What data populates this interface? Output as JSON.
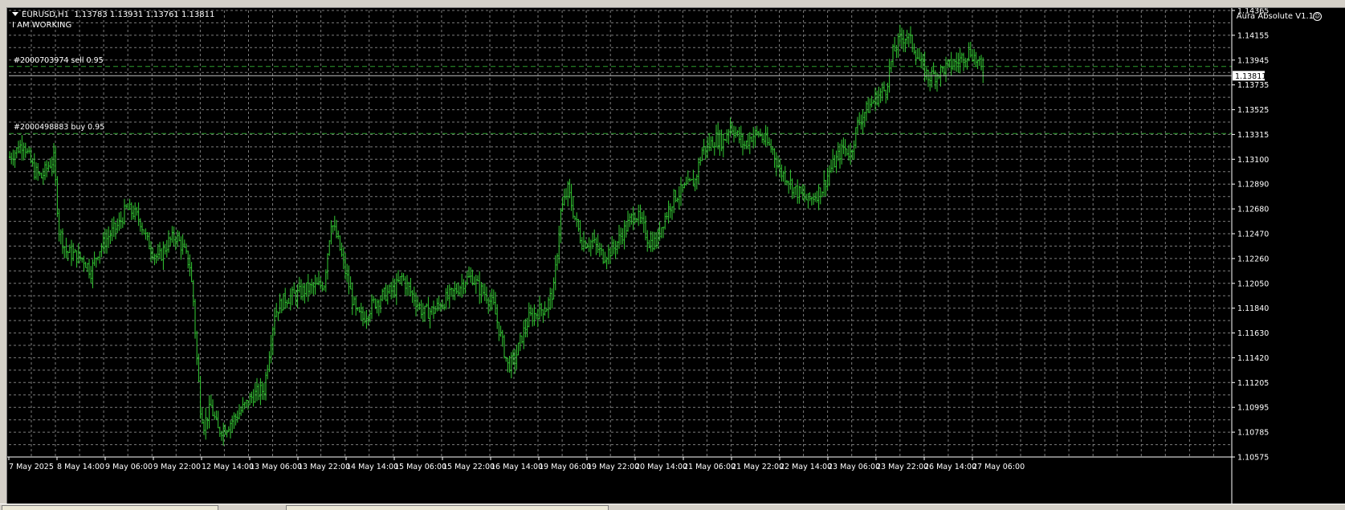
{
  "chart": {
    "symbol": "EURUSD,H1",
    "ohlc": "1.13783 1.13931 1.13761 1.13811",
    "status": "I AM WORKING",
    "expert": "Aura Absolute V1.1",
    "current_price": "1.13811",
    "colors": {
      "background": "#000000",
      "grid": "#8a8a8a",
      "candles": "#33cc33",
      "order_line": "#2ea02e",
      "bid_line": "#c0c0c0",
      "text": "#ffffff"
    }
  },
  "orders": [
    {
      "label": "#2000703974 sell 0.95",
      "price": 1.1389
    },
    {
      "label": "#2000498883 buy 0.95",
      "price": 1.1332
    }
  ],
  "price_axis": [
    "1.14365",
    "1.14155",
    "1.13945",
    "1.13735",
    "1.13525",
    "1.13315",
    "1.13100",
    "1.12890",
    "1.12680",
    "1.12470",
    "1.12260",
    "1.12050",
    "1.11840",
    "1.11630",
    "1.11420",
    "1.11205",
    "1.10995",
    "1.10785",
    "1.10575"
  ],
  "time_axis": [
    "7 May 2025",
    "8 May 14:00",
    "9 May 06:00",
    "9 May 22:00",
    "12 May 14:00",
    "13 May 06:00",
    "13 May 22:00",
    "14 May 14:00",
    "15 May 06:00",
    "15 May 22:00",
    "16 May 14:00",
    "19 May 06:00",
    "19 May 22:00",
    "20 May 14:00",
    "21 May 06:00",
    "21 May 22:00",
    "22 May 14:00",
    "23 May 06:00",
    "23 May 22:00",
    "26 May 14:00",
    "27 May 06:00"
  ],
  "chart_data": {
    "type": "ohlc",
    "title": "EURUSD,H1",
    "ylim": [
      1.10575,
      1.14365
    ],
    "key_points": [
      [
        0,
        1.1312
      ],
      [
        4,
        1.1318
      ],
      [
        8,
        1.1325
      ],
      [
        10,
        1.1315
      ],
      [
        14,
        1.13
      ],
      [
        18,
        1.1295
      ],
      [
        22,
        1.1305
      ],
      [
        25,
        1.131
      ],
      [
        28,
        1.125
      ],
      [
        32,
        1.1232
      ],
      [
        38,
        1.1228
      ],
      [
        42,
        1.1225
      ],
      [
        46,
        1.1215
      ],
      [
        50,
        1.1232
      ],
      [
        56,
        1.1245
      ],
      [
        62,
        1.1255
      ],
      [
        66,
        1.1268
      ],
      [
        70,
        1.1265
      ],
      [
        74,
        1.1258
      ],
      [
        78,
        1.124
      ],
      [
        84,
        1.1225
      ],
      [
        90,
        1.124
      ],
      [
        94,
        1.1245
      ],
      [
        98,
        1.1235
      ],
      [
        102,
        1.122
      ],
      [
        104,
        1.119
      ],
      [
        106,
        1.114
      ],
      [
        108,
        1.11
      ],
      [
        110,
        1.1085
      ],
      [
        114,
        1.11
      ],
      [
        118,
        1.108
      ],
      [
        122,
        1.1082
      ],
      [
        130,
        1.1095
      ],
      [
        138,
        1.111
      ],
      [
        144,
        1.1115
      ],
      [
        150,
        1.118
      ],
      [
        156,
        1.1192
      ],
      [
        162,
        1.1195
      ],
      [
        168,
        1.12
      ],
      [
        174,
        1.1202
      ],
      [
        178,
        1.1205
      ],
      [
        182,
        1.1258
      ],
      [
        186,
        1.124
      ],
      [
        190,
        1.1215
      ],
      [
        196,
        1.118
      ],
      [
        200,
        1.1175
      ],
      [
        206,
        1.1188
      ],
      [
        212,
        1.1195
      ],
      [
        218,
        1.12
      ],
      [
        222,
        1.121
      ],
      [
        228,
        1.1195
      ],
      [
        234,
        1.118
      ],
      [
        240,
        1.1182
      ],
      [
        246,
        1.119
      ],
      [
        252,
        1.1198
      ],
      [
        258,
        1.1208
      ],
      [
        262,
        1.121
      ],
      [
        266,
        1.12
      ],
      [
        270,
        1.1195
      ],
      [
        274,
        1.1185
      ],
      [
        278,
        1.116
      ],
      [
        282,
        1.1135
      ],
      [
        286,
        1.114
      ],
      [
        290,
        1.116
      ],
      [
        294,
        1.1175
      ],
      [
        300,
        1.1182
      ],
      [
        304,
        1.1185
      ],
      [
        308,
        1.12
      ],
      [
        312,
        1.1265
      ],
      [
        316,
        1.1285
      ],
      [
        320,
        1.126
      ],
      [
        324,
        1.124
      ],
      [
        330,
        1.124
      ],
      [
        336,
        1.1228
      ],
      [
        342,
        1.1235
      ],
      [
        348,
        1.125
      ],
      [
        354,
        1.1265
      ],
      [
        358,
        1.1255
      ],
      [
        362,
        1.124
      ],
      [
        366,
        1.124
      ],
      [
        370,
        1.1258
      ],
      [
        376,
        1.1278
      ],
      [
        382,
        1.1285
      ],
      [
        388,
        1.1292
      ],
      [
        392,
        1.1318
      ],
      [
        396,
        1.1322
      ],
      [
        400,
        1.1328
      ],
      [
        404,
        1.1325
      ],
      [
        408,
        1.134
      ],
      [
        412,
        1.133
      ],
      [
        416,
        1.1322
      ],
      [
        420,
        1.133
      ],
      [
        424,
        1.1332
      ],
      [
        428,
        1.1325
      ],
      [
        432,
        1.1318
      ],
      [
        436,
        1.13
      ],
      [
        440,
        1.1295
      ],
      [
        444,
        1.1285
      ],
      [
        448,
        1.128
      ],
      [
        452,
        1.1275
      ],
      [
        456,
        1.128
      ],
      [
        460,
        1.1285
      ],
      [
        464,
        1.13
      ],
      [
        468,
        1.131
      ],
      [
        472,
        1.132
      ],
      [
        476,
        1.1315
      ],
      [
        480,
        1.134
      ],
      [
        484,
        1.135
      ],
      [
        488,
        1.1358
      ],
      [
        492,
        1.1365
      ],
      [
        496,
        1.137
      ],
      [
        500,
        1.14
      ],
      [
        504,
        1.1412
      ],
      [
        508,
        1.1415
      ],
      [
        512,
        1.1405
      ],
      [
        516,
        1.139
      ],
      [
        520,
        1.138
      ],
      [
        524,
        1.1382
      ],
      [
        530,
        1.1388
      ],
      [
        536,
        1.1392
      ],
      [
        540,
        1.1398
      ],
      [
        544,
        1.1402
      ],
      [
        548,
        1.1392
      ],
      [
        552,
        1.1381
      ]
    ]
  }
}
